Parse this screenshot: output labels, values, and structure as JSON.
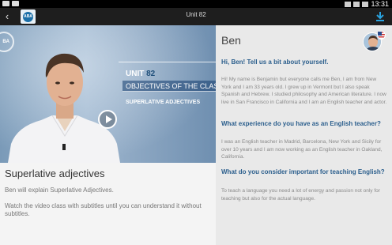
{
  "status_bar": {
    "time": "13:31",
    "icons": [
      "image-icon",
      "wifi-icon",
      "signal-icon",
      "battery-icon"
    ]
  },
  "app_bar": {
    "title": "Unit  82",
    "logo_text": "ABA",
    "back_icon": "chevron-left-icon",
    "download_icon": "download-icon"
  },
  "video": {
    "seal_text": "BA",
    "unit_word": "UNIT",
    "unit_number": "82",
    "objectives_title": "OBJECTIVES OF THE CLASS",
    "objective_item": "SUPERLATIVE ADJECTIVES",
    "play_icon": "play-icon"
  },
  "lesson": {
    "title": "Superlative adjectives",
    "description": "Ben will explain Superlative Adjectives.",
    "hint": "Watch the video class with subtitles until you can understand it without subtitles."
  },
  "teacher": {
    "name": "Ben",
    "sections": [
      {
        "question": "Hi, Ben! Tell us a bit about yourself.",
        "answer": "Hi! My name is Benjamin but everyone calls me Ben, I am from New York and I am 33 years old. I grew up in Vermont but I also speak Spanish and Hebrew. I studied philosophy and American literature. I now live in San Francisco in California and I am an English teacher and actor."
      },
      {
        "question": "What experience do you have as an English teacher?",
        "answer": "I was an English teacher in Madrid, Barcelona, New York and Sicily for over 10 years and I am now working as an English teacher in Oakland, California."
      },
      {
        "question": "What do you consider important for teaching English?",
        "answer": "To teach a language you need a lot of energy and passion not only for teaching but also for the actual language."
      }
    ]
  },
  "colors": {
    "app_bar": "#1e1e1e",
    "question_blue": "#2c5f8d",
    "download_blue": "#29a3e0"
  }
}
